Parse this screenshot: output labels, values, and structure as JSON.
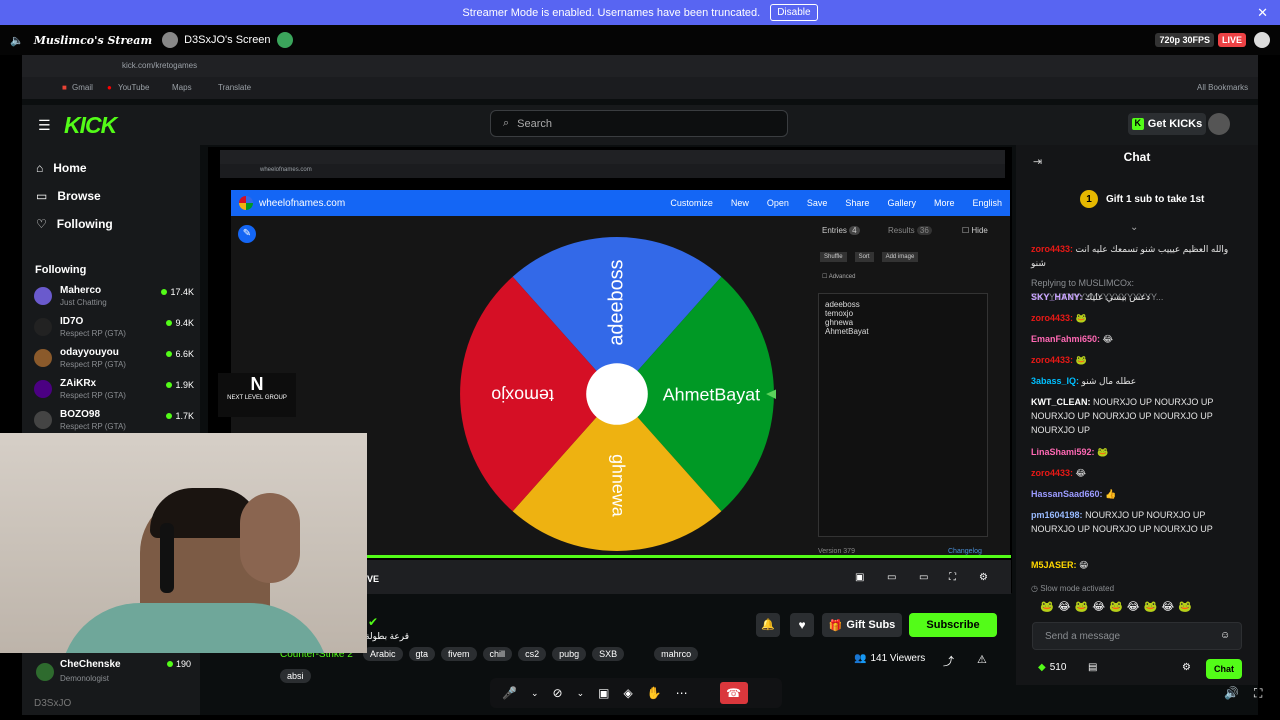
{
  "banner": {
    "text": "Streamer Mode is enabled. Usernames have been truncated.",
    "button": "Disable"
  },
  "header": {
    "stream1": "Muslimco's Stream",
    "stream2": "D3SxJO's Screen",
    "quality": "720p 30FPS",
    "live": "LIVE"
  },
  "browser": {
    "url": "kick.com/kretogames",
    "bookmarks": [
      "Gmail",
      "YouTube",
      "Maps",
      "Translate"
    ],
    "all_bookmarks": "All Bookmarks"
  },
  "kick": {
    "search_placeholder": "Search",
    "get_kicks": "Get KICKs",
    "nav": [
      "Home",
      "Browse",
      "Following"
    ],
    "following_title": "Following",
    "following": [
      {
        "name": "Maherco",
        "sub": "Just Chatting",
        "viewers": "17.4K"
      },
      {
        "name": "ID7O",
        "sub": "Respect RP (GTA)",
        "viewers": "9.4K"
      },
      {
        "name": "odayyouyou",
        "sub": "Respect RP (GTA)",
        "viewers": "6.6K"
      },
      {
        "name": "ZAiKRx",
        "sub": "Respect RP (GTA)",
        "viewers": "1.9K"
      },
      {
        "name": "BOZO98",
        "sub": "Respect RP (GTA)",
        "viewers": "1.7K"
      }
    ],
    "logo": "KICK"
  },
  "wheel": {
    "site": "wheelofnames.com",
    "toolbar": [
      "Customize",
      "New",
      "Open",
      "Save",
      "Share",
      "Gallery",
      "More",
      "English"
    ],
    "segments": [
      "adeeboss",
      "ahmetbayat",
      "ghnewa",
      "temoxjo"
    ],
    "segment_labels": [
      "adeeboss",
      "AhmetBayat",
      "ghnewa",
      "temoxjo"
    ],
    "entries_tab": "Entries",
    "entries_count": "4",
    "results_tab": "Results",
    "results_count": "36",
    "hide": "Hide",
    "shuffle": "Shuffle",
    "sort": "Sort",
    "add_image": "Add image",
    "advanced": "Advanced",
    "entries": [
      "adeeboss",
      "temoxjo",
      "ghnewa",
      "AhmetBayat"
    ],
    "version": "Version 379",
    "changelog": "Changelog",
    "colors": {
      "blue": "#3369e8",
      "green": "#009925",
      "yellow": "#eeb211",
      "red": "#d50f25"
    },
    "logo_text": "NEXT LEVEL GROUP"
  },
  "stream_info": {
    "arabic_title": "قرعة بطولة",
    "category": "Counter-Strike 2",
    "tags": [
      "Arabic",
      "gta",
      "fivem",
      "chill",
      "cs2",
      "pubg",
      "SXB",
      "mahrco"
    ],
    "extra_tag": "absi",
    "viewers": "141 Viewers",
    "gift_subs": "Gift Subs",
    "subscribe": "Subscribe",
    "live_label": "VE"
  },
  "gifter": {
    "name": "CheChenske",
    "sub": "Demonologist",
    "count": "190"
  },
  "chat": {
    "title": "Chat",
    "gift_banner": "Gift 1 sub to take 1st",
    "messages": [
      {
        "user": "zoro4433:",
        "text": "والله العظيم عيييب شنو تسمعك عليه انت شنو",
        "color": "#e91916"
      },
      {
        "user": "Replying to MUSLIMCOx:",
        "text": "YYYYYYYYYYYYYYYYYYYYY...",
        "color": "#8a8d91"
      },
      {
        "user": "SKY_HANY:",
        "text": "دعس بيسي عليك",
        "color": "#c8a2ff"
      },
      {
        "user": "zoro4433:",
        "text": "",
        "color": "#e91916"
      },
      {
        "user": "EmanFahmi650:",
        "text": "",
        "color": "#ff69b4"
      },
      {
        "user": "zoro4433:",
        "text": "",
        "color": "#e91916"
      },
      {
        "user": "3abass_IQ:",
        "text": "عطله مال شنو",
        "color": "#00bfff"
      },
      {
        "user": "KWT_CLEAN:",
        "text": "NOURXJO UP NOURXJO UP NOURXJO UP NOURXJO UP NOURXJO UP NOURXJO UP",
        "color": "#ffffff"
      },
      {
        "user": "LinaShami592:",
        "text": "",
        "color": "#ff69b4"
      },
      {
        "user": "zoro4433:",
        "text": "",
        "color": "#e91916"
      },
      {
        "user": "HassanSaad660:",
        "text": "",
        "color": "#9b9bff"
      },
      {
        "user": "pm1604198:",
        "text": "NOURXJO UP NOURXJO UP NOURXJO UP NOURXJO UP NOURXJO UP",
        "color": "#9bf"
      },
      {
        "user": "M5JASER:",
        "text": "",
        "color": "#ffd700"
      }
    ],
    "slow_mode": "Slow mode activated",
    "input_placeholder": "Send a message",
    "points": "510",
    "chat_button": "Chat"
  },
  "discord_footer": {
    "user": "D3SxJO"
  }
}
